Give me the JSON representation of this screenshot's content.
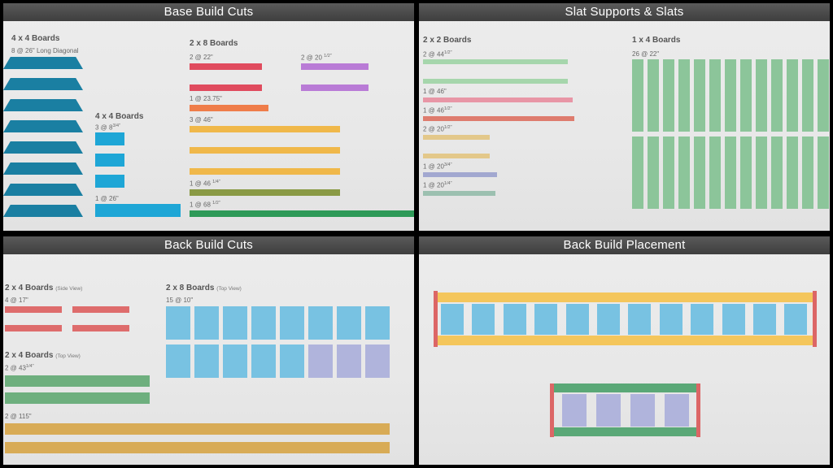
{
  "colors": {
    "teal": "#1a7fa2",
    "sky": "#1ea6d6",
    "red": "#e04b5e",
    "purple": "#b97bd6",
    "orange": "#ef7d4a",
    "yellow": "#f0b84a",
    "olive": "#8a9a45",
    "green": "#2e9a58",
    "slat_green": "#8cc59a",
    "light_green": "#a6d6ac",
    "pink": "#e896a6",
    "salmon": "#de7c6e",
    "tan": "#e3c88a",
    "lavender": "#a2a8d0",
    "sage": "#9cc0b0",
    "back_red": "#de6c6c",
    "back_green": "#6eaf7e",
    "back_gold": "#d8ab56",
    "back_blue": "#78c2e2",
    "back_periwinkle": "#b0b4dc",
    "placement_yellow": "#f4c65c",
    "placement_post": "#dc6666",
    "placement_green": "#5aa877"
  },
  "base": {
    "title": "Base Build Cuts",
    "g1": {
      "title": "4 x 4 Boards",
      "label": "8 @ 26\" Long Diagonal"
    },
    "g2": {
      "title": "4 x 4 Boards",
      "l1_main": "3 @ 8",
      "l1_sup": "3/4\"",
      "l2": "1 @ 26\""
    },
    "g3": {
      "title": "2 x 8 Boards",
      "l1": "2 @ 22\"",
      "l2_main": "2 @ 20",
      "l2_sup": "1/2\"",
      "l3": "1 @ 23.75\"",
      "l4": "3 @ 46\"",
      "l5_main": "1 @ 46",
      "l5_sup": "1/4\"",
      "l6_main": "1 @ 68",
      "l6_sup": "1/2\""
    }
  },
  "slat": {
    "title": "Slat Supports & Slats",
    "g1": {
      "title": "2 x 2 Boards",
      "l1_main": "2 @ 44",
      "l1_sup": "1/2\"",
      "l2": "1 @ 46\"",
      "l3_main": "1 @ 46",
      "l3_sup": "1/2\"",
      "l4_main": "2 @ 20",
      "l4_sup": "1/2\"",
      "l5_main": "1 @ 20",
      "l5_sup": "3/4\"",
      "l6_main": "1 @ 20",
      "l6_sup": "1/4\""
    },
    "g2": {
      "title": "1 x 4 Boards",
      "label": "26 @ 22\""
    }
  },
  "back": {
    "title": "Back Build Cuts",
    "g1": {
      "title": "2 x 4 Boards",
      "view": "(Side View)",
      "label": "4 @ 17\""
    },
    "g2": {
      "title": "2 x 8 Boards",
      "view": "(Top View)",
      "label": "15 @ 10\""
    },
    "g3": {
      "title": "2 x 4 Boards",
      "view": "(Top View)",
      "label_main": "2 @ 43",
      "label_sup": "1/4\""
    },
    "g4": {
      "label": "2 @ 115\""
    }
  },
  "placement": {
    "title": "Back Build Placement"
  }
}
